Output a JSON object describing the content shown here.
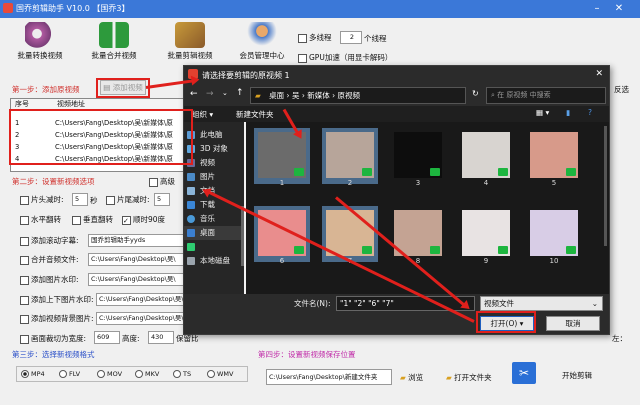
{
  "app": {
    "title": "国乔剪辑助手 V10.0    【国乔3】",
    "toolbar": [
      {
        "label": "批量转换视频",
        "icon": "film-reel-icon"
      },
      {
        "label": "批量合并视频",
        "icon": "merge-icon"
      },
      {
        "label": "批量剪辑视频",
        "icon": "scissors-film-icon"
      },
      {
        "label": "会员管理中心",
        "icon": "users-icon"
      }
    ],
    "options": {
      "multithread": "多线程",
      "threads_value": "2",
      "threads_label": "个线程",
      "gpu": "GPU加速（用显卡解码）"
    },
    "step1": "第一步：添加原视频",
    "add_video": "添加视频",
    "table": {
      "headers": [
        "序号",
        "视频地址"
      ],
      "rows": [
        {
          "no": "1",
          "path": "C:\\Users\\Fang\\Desktop\\吴\\新媒体\\原"
        },
        {
          "no": "2",
          "path": "C:\\Users\\Fang\\Desktop\\吴\\新媒体\\原"
        },
        {
          "no": "3",
          "path": "C:\\Users\\Fang\\Desktop\\吴\\新媒体\\原"
        },
        {
          "no": "4",
          "path": "C:\\Users\\Fang\\Desktop\\吴\\新媒体\\原"
        }
      ]
    },
    "step2": "第二步：设置新视频选项",
    "advanced": "高级",
    "cut_head": "片头减时:",
    "cut_head_val": "5",
    "seconds": "秒",
    "cut_tail": "片尾减时:",
    "cut_tail_val": "5",
    "hflip": "水平翻转",
    "vflip": "垂直翻转",
    "rotate90": "顺时90度",
    "scroll_sub": "添加滚动字幕:",
    "scroll_sub_val": "国乔剪辑助手yyds",
    "merge_file": "合并音频文件:",
    "merge_file_val": "C:\\Users\\Fang\\Desktop\\吴\\",
    "add_image_wm": "添加图片水印:",
    "add_image_wm_val": "C:\\Users\\Fang\\Desktop\\吴\\",
    "add_topbottom": "添加上下图片水印:",
    "add_topbottom_val": "C:\\Users\\Fang\\Desktop\\吴\\",
    "add_bg": "添加视频背景图片:",
    "add_bg_val": "C:\\Users\\Fang\\Desktop\\吴\\",
    "crop": "画面裁切为宽度:",
    "crop_w": "609",
    "crop_h_label": "高度:",
    "crop_h": "430",
    "keep_ratio": "保留比",
    "left_label": "左：",
    "step3": "第三步：选择新视频格式",
    "formats": [
      "MP4",
      "FLV",
      "MOV",
      "MKV",
      "TS",
      "WMV"
    ],
    "step4": "第四步：设置新视频保存位置",
    "save_path": "C:\\Users\\Fang\\Desktop\\新建文件夹",
    "browse": "浏览",
    "open_folder": "打开文件夹",
    "start": "开始剪辑",
    "reverse": "反选"
  },
  "dialog": {
    "title": "请选择要剪辑的原视频 1",
    "breadcrumb": [
      "桌面",
      "吴",
      "新媒体",
      "原视频"
    ],
    "search_placeholder": "在 原视频 中搜索",
    "organize": "组织 ▾",
    "new_folder": "新建文件夹",
    "nav": [
      {
        "label": "此电脑",
        "color": "#5b9bd5"
      },
      {
        "label": "3D 对象",
        "color": "#5fa8e0"
      },
      {
        "label": "视频",
        "color": "#6a6a9a"
      },
      {
        "label": "图片",
        "color": "#4b8bc8"
      },
      {
        "label": "文档",
        "color": "#8ab4d8"
      },
      {
        "label": "下载",
        "color": "#3a86d6"
      },
      {
        "label": "音乐",
        "color": "#4a9ad8"
      },
      {
        "label": "桌面",
        "color": "#3b7fd0"
      },
      {
        "label": "",
        "color": "#2ecc71"
      },
      {
        "label": "本地磁盘",
        "color": "#9aa4ad"
      }
    ],
    "files": [
      {
        "cap": "1",
        "color": "#6b6b6b",
        "sel": true
      },
      {
        "cap": "2",
        "color": "#b7a59a",
        "sel": true
      },
      {
        "cap": "3",
        "color": "#0d0d0d",
        "sel": false
      },
      {
        "cap": "4",
        "color": "#d8d4d0",
        "sel": false
      },
      {
        "cap": "5",
        "color": "#d79a8a",
        "sel": false
      },
      {
        "cap": "6",
        "color": "#e98d8d",
        "sel": true
      },
      {
        "cap": "7",
        "color": "#d8b594",
        "sel": true
      },
      {
        "cap": "8",
        "color": "#c4a393",
        "sel": false
      },
      {
        "cap": "9",
        "color": "#e8e3e3",
        "sel": false
      },
      {
        "cap": "10",
        "color": "#d8cde6",
        "sel": false
      }
    ],
    "filename_label": "文件名(N):",
    "filename_val": "\"1\" \"2\" \"6\" \"7\"",
    "filetype": "视频文件",
    "open": "打开(O)",
    "cancel": "取消"
  },
  "colors": {
    "accent": "#3b78d8",
    "annotation_red": "#e0201c",
    "badge_green": "#1db53f"
  }
}
